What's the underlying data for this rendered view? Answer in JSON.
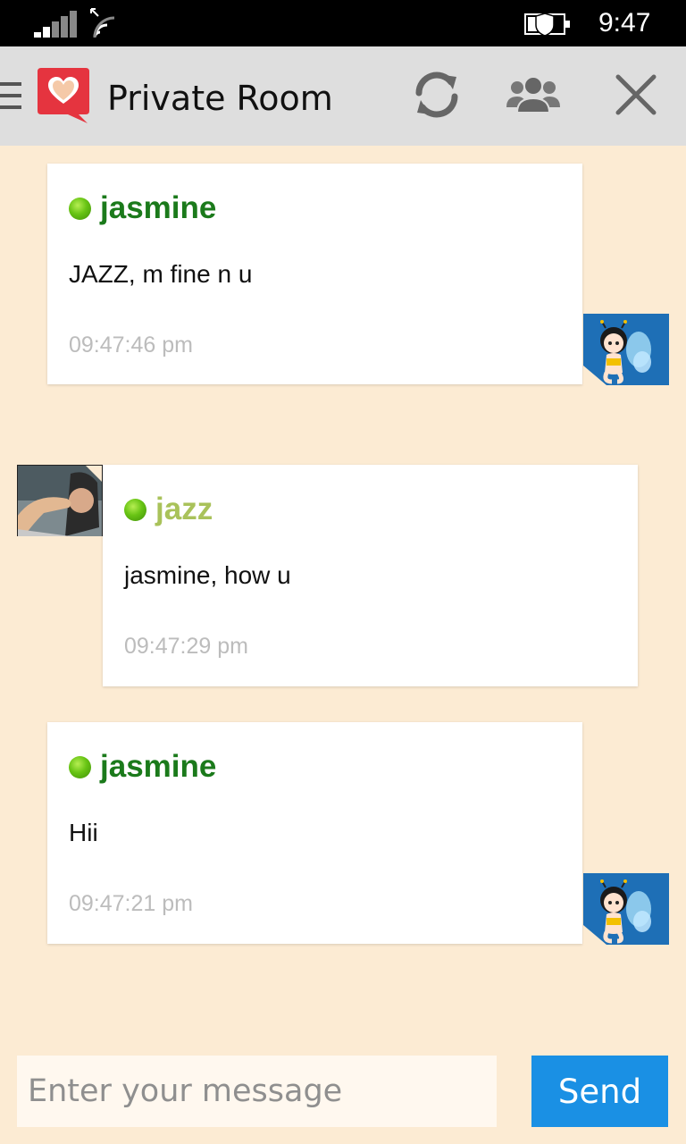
{
  "status_bar": {
    "time": "9:47",
    "icons": [
      "signal-icon",
      "wifi-icon",
      "battery-saver-icon"
    ]
  },
  "header": {
    "title": "Private Room",
    "icons": [
      "menu-icon",
      "heart-chat-logo",
      "refresh-icon",
      "users-icon",
      "close-icon"
    ]
  },
  "messages": [
    {
      "sender": "jasmine",
      "text": "JAZZ, m fine n u",
      "time": "09:47:46 pm",
      "name_color": "#1b7a1b",
      "avatar": "fairy-avatar"
    },
    {
      "sender": "jazz",
      "text": "jasmine, how u",
      "time": "09:47:29 pm",
      "name_color": "#a9c25a",
      "avatar": "jazz-avatar"
    },
    {
      "sender": "jasmine",
      "text": "Hii",
      "time": "09:47:21 pm",
      "name_color": "#1b7a1b",
      "avatar": "fairy-avatar"
    }
  ],
  "composer": {
    "placeholder": "Enter your message",
    "value": "",
    "send_label": "Send"
  },
  "colors": {
    "background": "#fcebd3",
    "header": "#dedede",
    "send_button": "#1a90e4",
    "online_dot": "#5cb811"
  }
}
